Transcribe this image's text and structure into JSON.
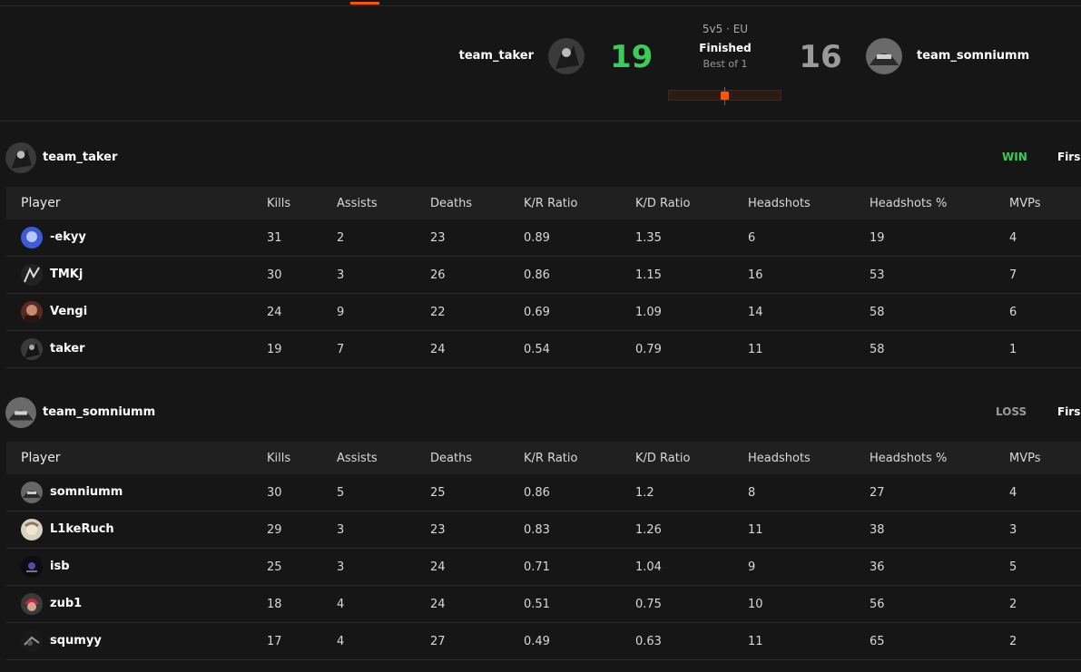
{
  "match": {
    "team_a": {
      "name": "team_taker",
      "score": "19"
    },
    "team_b": {
      "name": "team_somniumm",
      "score": "16"
    },
    "mode": "5v5 · EU",
    "status": "Finished",
    "best_of": "Best of 1"
  },
  "colors": {
    "accent": "#ff5500",
    "win": "#3dcc5a",
    "loss": "#9a9a9a"
  },
  "columns": [
    "Player",
    "Kills",
    "Assists",
    "Deaths",
    "K/R Ratio",
    "K/D Ratio",
    "Headshots",
    "Headshots %",
    "MVPs"
  ],
  "teams": [
    {
      "name": "team_taker",
      "result": "WIN",
      "extra": "Firs",
      "players": [
        {
          "name": "-ekyy",
          "kills": "31",
          "assists": "2",
          "deaths": "23",
          "kr": "0.89",
          "kd": "1.35",
          "hs": "6",
          "hsp": "19",
          "mvps": "4"
        },
        {
          "name": "TMKj",
          "kills": "30",
          "assists": "3",
          "deaths": "26",
          "kr": "0.86",
          "kd": "1.15",
          "hs": "16",
          "hsp": "53",
          "mvps": "7"
        },
        {
          "name": "Vengi",
          "kills": "24",
          "assists": "9",
          "deaths": "22",
          "kr": "0.69",
          "kd": "1.09",
          "hs": "14",
          "hsp": "58",
          "mvps": "6"
        },
        {
          "name": "taker",
          "kills": "19",
          "assists": "7",
          "deaths": "24",
          "kr": "0.54",
          "kd": "0.79",
          "hs": "11",
          "hsp": "58",
          "mvps": "1"
        }
      ]
    },
    {
      "name": "team_somniumm",
      "result": "LOSS",
      "extra": "Firs",
      "players": [
        {
          "name": "somniumm",
          "kills": "30",
          "assists": "5",
          "deaths": "25",
          "kr": "0.86",
          "kd": "1.2",
          "hs": "8",
          "hsp": "27",
          "mvps": "4"
        },
        {
          "name": "L1keRuch",
          "kills": "29",
          "assists": "3",
          "deaths": "23",
          "kr": "0.83",
          "kd": "1.26",
          "hs": "11",
          "hsp": "38",
          "mvps": "3"
        },
        {
          "name": "isb",
          "kills": "25",
          "assists": "3",
          "deaths": "24",
          "kr": "0.71",
          "kd": "1.04",
          "hs": "9",
          "hsp": "36",
          "mvps": "5"
        },
        {
          "name": "zub1",
          "kills": "18",
          "assists": "4",
          "deaths": "24",
          "kr": "0.51",
          "kd": "0.75",
          "hs": "10",
          "hsp": "56",
          "mvps": "2"
        },
        {
          "name": "squmyy",
          "kills": "17",
          "assists": "4",
          "deaths": "27",
          "kr": "0.49",
          "kd": "0.63",
          "hs": "11",
          "hsp": "65",
          "mvps": "2"
        }
      ]
    }
  ]
}
